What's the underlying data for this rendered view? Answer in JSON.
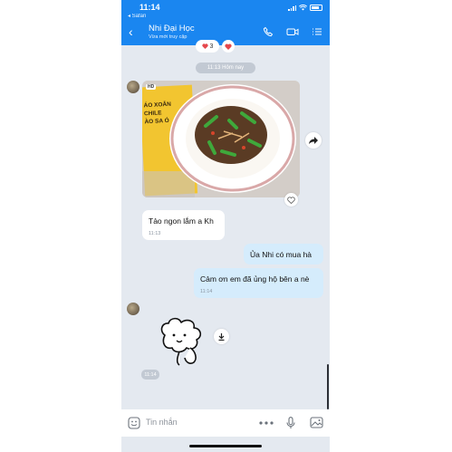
{
  "status_bar": {
    "time": "11:14",
    "back_app": "◂ Safari"
  },
  "header": {
    "back_icon": "chevron-left-icon",
    "contact_name": "Nhi Đại Học",
    "contact_status": "Vừa mới truy cập",
    "icons": [
      "phone-icon",
      "video-call-icon",
      "list-icon"
    ]
  },
  "reactions": {
    "icon": "heart-icon",
    "count": "3"
  },
  "divider_time": "11:13 Hôm nay",
  "image_message": {
    "badge": "HD",
    "package_text": [
      "ÁO XOẮN",
      "CHILE",
      "ÀO SA Ó"
    ],
    "forward_icon": "share-arrow-icon",
    "react_icon": "heart-outline-icon"
  },
  "messages": [
    {
      "side": "in",
      "text": "Tảo ngon lắm a Kh",
      "time": "11:13"
    },
    {
      "side": "out",
      "text": "Ủa Nhi có mua hà",
      "time": ""
    },
    {
      "side": "out",
      "text": "Cảm ơn em đã ủng hộ bên a nè",
      "time": "11:14"
    }
  ],
  "sticker": {
    "download_icon": "download-icon",
    "time": "11:14"
  },
  "input_bar": {
    "placeholder": "Tin nhắn",
    "icons": [
      "sticker-icon",
      "more-icon",
      "microphone-icon",
      "image-icon"
    ]
  },
  "colors": {
    "header": "#1a86f0",
    "chat_bg": "#e4e9f0",
    "outgoing_bubble": "#d5ecfc",
    "incoming_bubble": "#ffffff"
  }
}
